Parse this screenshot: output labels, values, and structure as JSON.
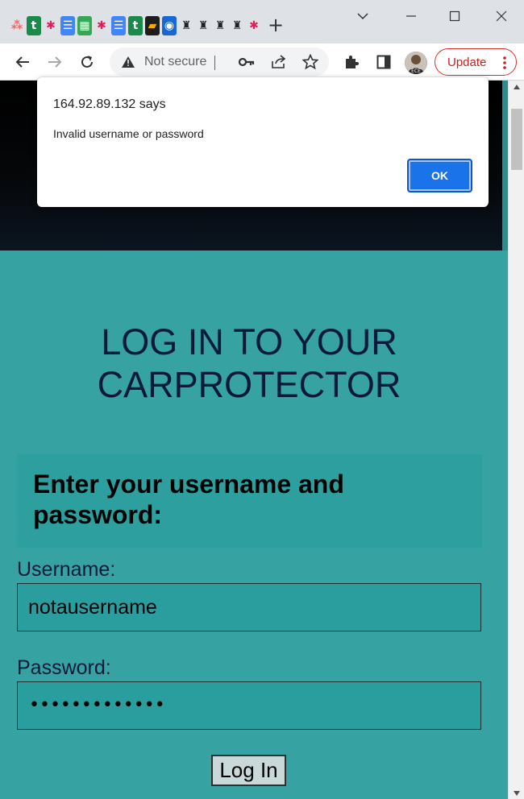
{
  "browser": {
    "tab_favicons": [
      {
        "name": "asana-icon",
        "glyph": "⁂",
        "color": "#f06a6a",
        "bg": "transparent"
      },
      {
        "name": "trello-icon",
        "glyph": "t",
        "color": "#ffffff",
        "bg": "#1a8a4a"
      },
      {
        "name": "slack-icon",
        "glyph": "✱",
        "color": "#e01e5a",
        "bg": "transparent"
      },
      {
        "name": "docs-icon",
        "glyph": "☰",
        "color": "#ffffff",
        "bg": "#4285f4"
      },
      {
        "name": "sheets-icon",
        "glyph": "▦",
        "color": "#ffffff",
        "bg": "#34a853"
      },
      {
        "name": "slack-icon",
        "glyph": "✱",
        "color": "#e01e5a",
        "bg": "transparent"
      },
      {
        "name": "docs-icon",
        "glyph": "☰",
        "color": "#ffffff",
        "bg": "#4285f4"
      },
      {
        "name": "trello-icon",
        "glyph": "t",
        "color": "#ffffff",
        "bg": "#1a8a4a"
      },
      {
        "name": "stripes-icon",
        "glyph": "▰",
        "color": "#f9ab00",
        "bg": "#1e1e1e"
      },
      {
        "name": "site-icon",
        "glyph": "◉",
        "color": "#ffffff",
        "bg": "#1967d2"
      },
      {
        "name": "tab-favicon-icon",
        "glyph": "♜",
        "color": "#202124",
        "bg": "transparent"
      },
      {
        "name": "tab-favicon-icon",
        "glyph": "♜",
        "color": "#202124",
        "bg": "transparent"
      },
      {
        "name": "tab-favicon-icon",
        "glyph": "♜",
        "color": "#202124",
        "bg": "transparent"
      },
      {
        "name": "tab-favicon-icon",
        "glyph": "♜",
        "color": "#202124",
        "bg": "transparent"
      },
      {
        "name": "slack-icon",
        "glyph": "✱",
        "color": "#e01e5a",
        "bg": "transparent"
      }
    ],
    "new_tab": "+",
    "address": "Not secure",
    "update_label": "Update"
  },
  "dialog": {
    "origin": "164.92.89.132 says",
    "message": "Invalid username or password",
    "ok_label": "OK"
  },
  "page": {
    "title_line1": "LOG IN TO YOUR",
    "title_line2": "CARPROTECTOR",
    "form_header": "Enter your username and password:",
    "username_label": "Username:",
    "username_value": "notausername",
    "password_label": "Password:",
    "password_mask": "•••••••••••••",
    "login_label": "Log In"
  },
  "colors": {
    "page_bg": "#36a2a2",
    "title": "#0b1a3a",
    "dialog_button": "#1a73e8",
    "update_border": "#d93025"
  }
}
